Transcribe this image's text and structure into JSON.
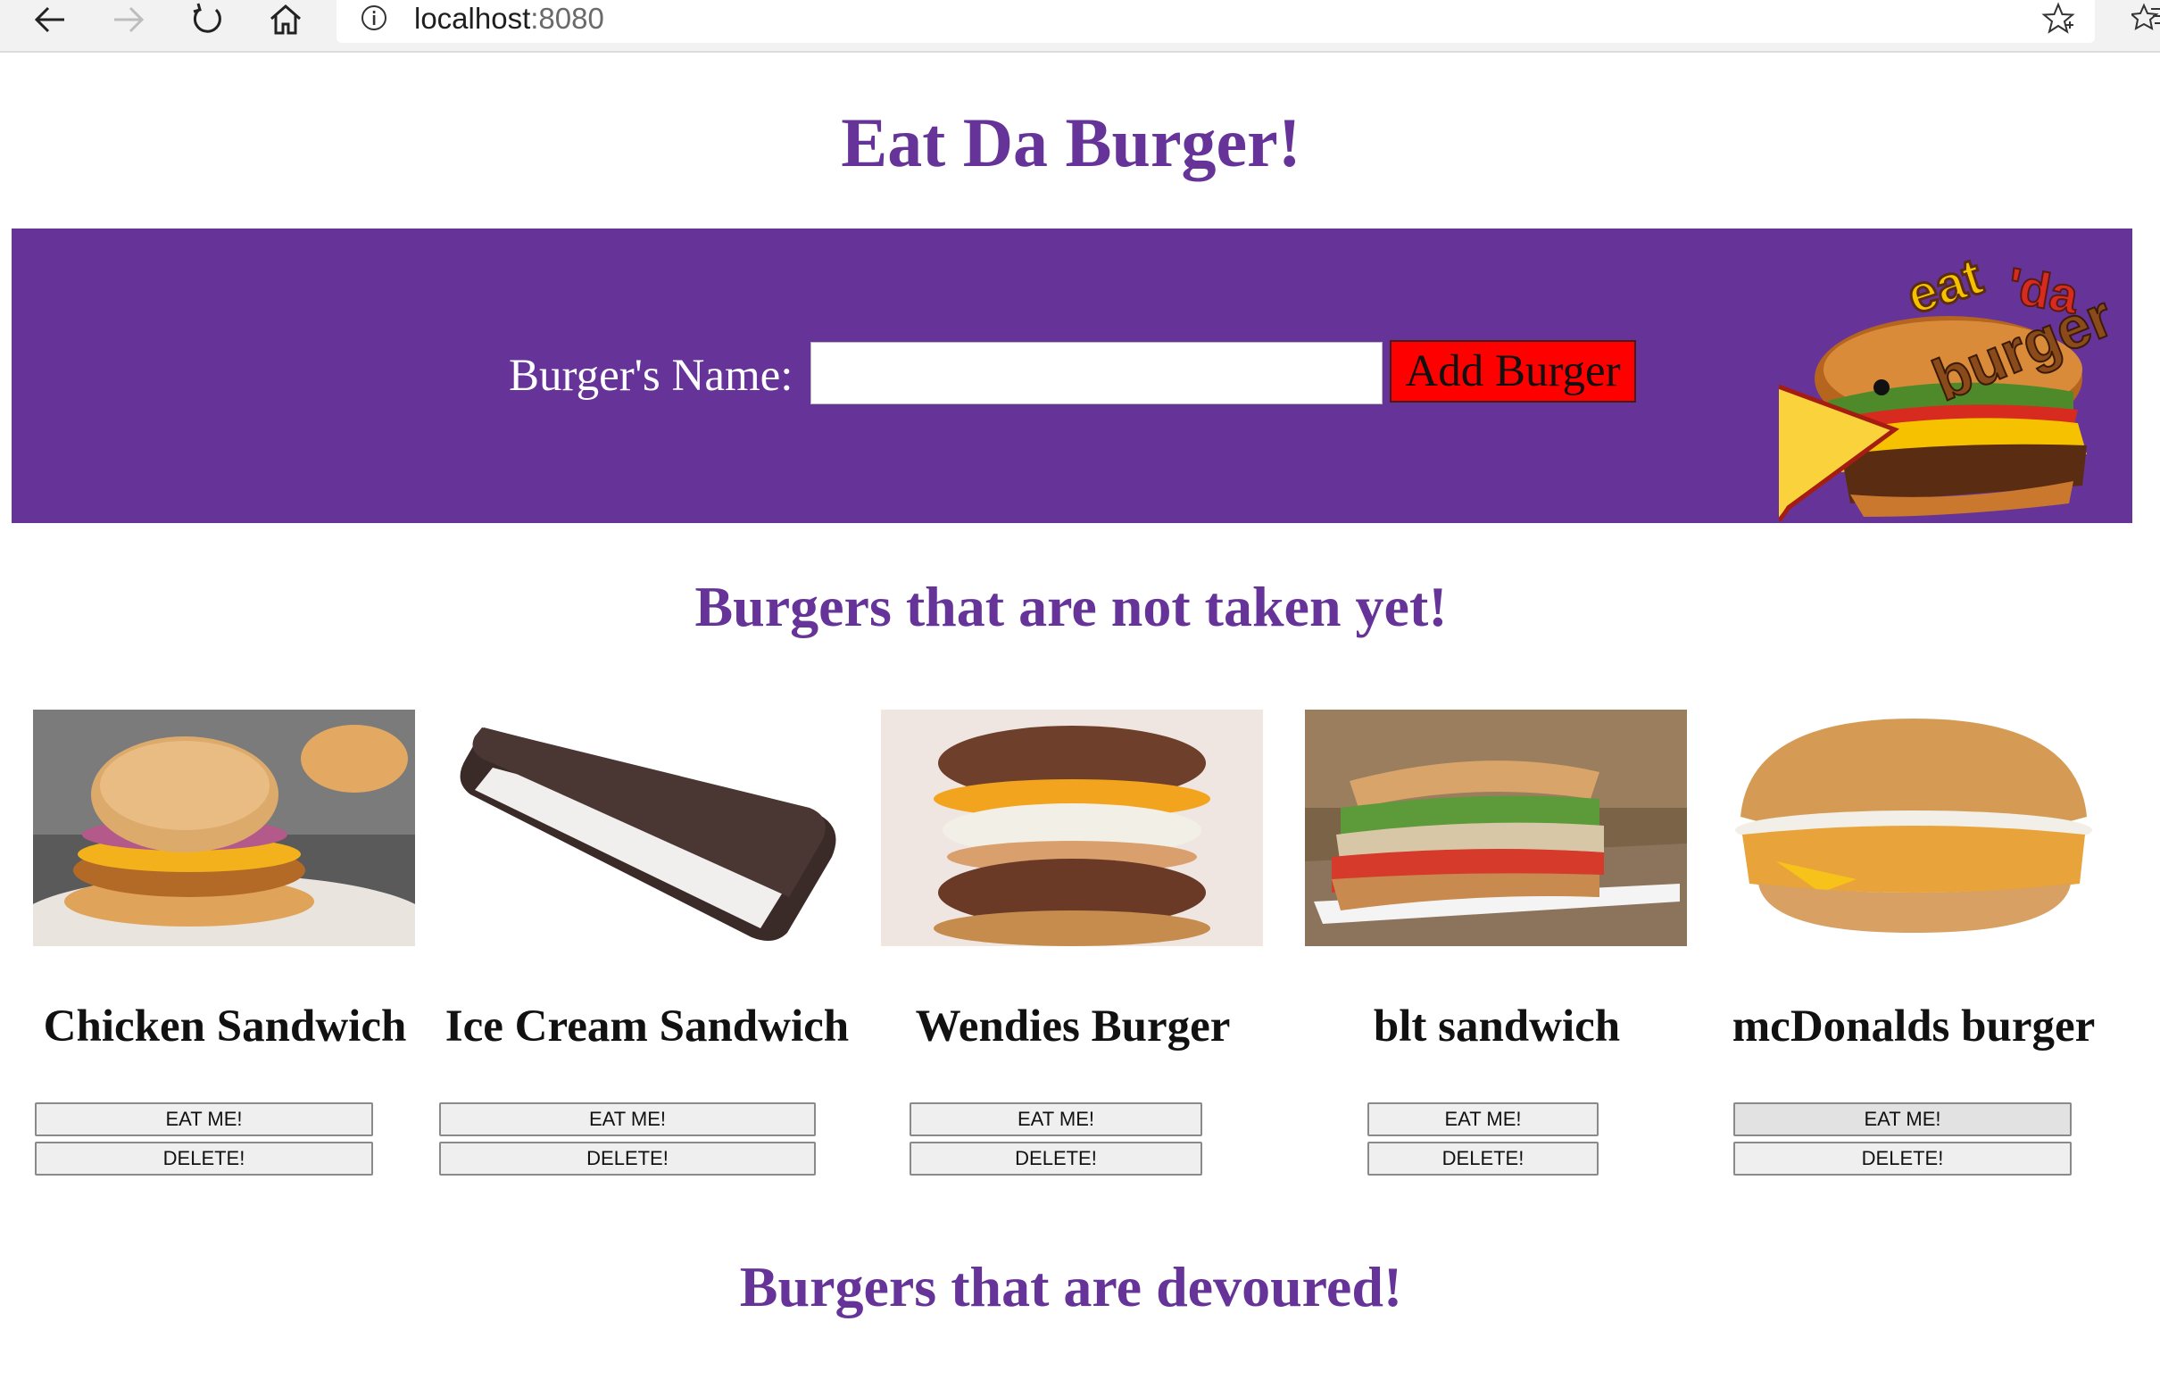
{
  "browser": {
    "url_host": "localhost",
    "url_port": ":8080",
    "icons": [
      "back-icon",
      "forward-icon",
      "refresh-icon",
      "home-icon",
      "info-icon",
      "favorite-star-icon",
      "favorites-bar-icon"
    ]
  },
  "page": {
    "title": "Eat Da Burger!",
    "colors": {
      "accent": "#663399",
      "button": "#ff0000"
    }
  },
  "form": {
    "label": "Burger's Name:",
    "input_value": "",
    "submit_label": "Add Burger"
  },
  "logo": {
    "text_1": "eat",
    "text_2": "'da",
    "text_3": "burger"
  },
  "not_taken": {
    "heading": "Burgers that are not taken yet!",
    "items": [
      {
        "name": "Chicken Sandwich",
        "eat_label": "EAT ME!",
        "delete_label": "DELETE!"
      },
      {
        "name": "Ice Cream Sandwich",
        "eat_label": "EAT ME!",
        "delete_label": "DELETE!"
      },
      {
        "name": "Wendies Burger",
        "eat_label": "EAT ME!",
        "delete_label": "DELETE!"
      },
      {
        "name": "blt sandwich",
        "eat_label": "EAT ME!",
        "delete_label": "DELETE!"
      },
      {
        "name": "mcDonalds burger",
        "eat_label": "EAT ME!",
        "delete_label": "DELETE!"
      }
    ]
  },
  "devoured": {
    "heading": "Burgers that are devoured!"
  }
}
